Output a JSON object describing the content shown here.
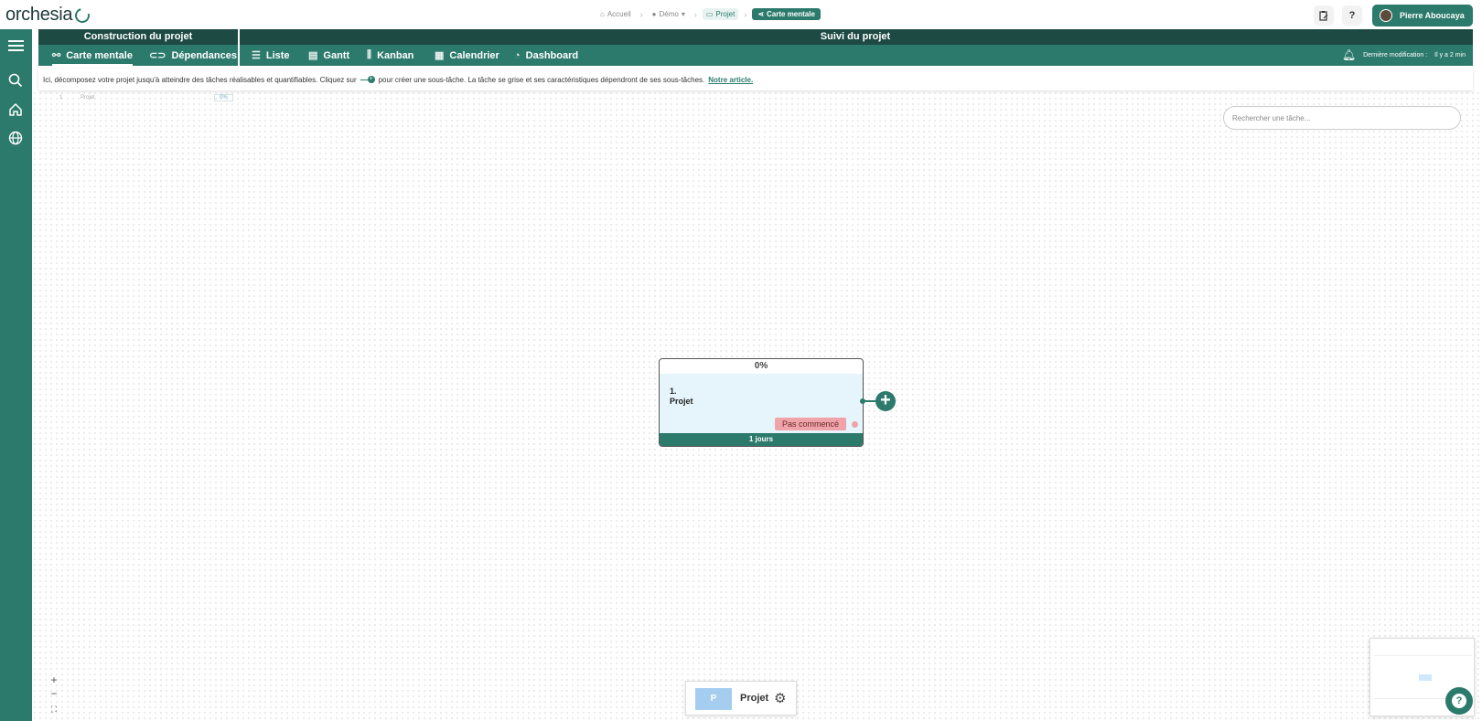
{
  "app": {
    "logo_text": "orchesia"
  },
  "breadcrumb": {
    "items": [
      {
        "label": "Accueil",
        "icon": "home-icon"
      },
      {
        "label": "Démo",
        "icon": "org-icon"
      },
      {
        "label": "Projet",
        "icon": "folder-icon"
      },
      {
        "label": "Carte mentale",
        "icon": "mindmap-icon"
      }
    ]
  },
  "header": {
    "help_label": "?",
    "user_name": "Pierre Aboucaya"
  },
  "nav": {
    "section_build": "Construction du projet",
    "section_follow": "Suivi du projet",
    "tabs": [
      {
        "label": "Carte mentale",
        "icon": "mindmap-icon",
        "active": true
      },
      {
        "label": "Dépendances",
        "icon": "link-icon",
        "active": false
      },
      {
        "label": "Liste",
        "icon": "list-icon",
        "active": false
      },
      {
        "label": "Gantt",
        "icon": "gantt-icon",
        "active": false
      },
      {
        "label": "Kanban",
        "icon": "kanban-icon",
        "active": false
      },
      {
        "label": "Calendrier",
        "icon": "calendar-icon",
        "active": false
      },
      {
        "label": "Dashboard",
        "icon": "dashboard-icon",
        "active": false
      }
    ],
    "last_modified_label": "Dernière modification :",
    "last_modified_value": "Il y a 2 min"
  },
  "info": {
    "text_before": "Ici, décomposez votre projet jusqu'à atteindre des tâches réalisables et quantifiables. Cliquez sur",
    "text_after": "pour créer une sous-tâche.  La tâche se grise et ses caractéristiques dépendront de ses sous-tâches.",
    "link": "Notre article."
  },
  "mini_row": {
    "num": "1",
    "name": "Projet",
    "pct": "0%"
  },
  "search": {
    "placeholder": "Rechercher une tâche..."
  },
  "card": {
    "pct": "0%",
    "number": "1.",
    "title": "Projet",
    "status": "Pas commencé",
    "status_color": "#f0a3a8",
    "duration": "1 jours"
  },
  "zoom": {
    "in": "+",
    "out": "−",
    "fit": "⛶"
  },
  "project_pill": {
    "initial": "P",
    "name": "Projet"
  },
  "colors": {
    "primary": "#2c7a6c",
    "primary_dark": "#1e4a44"
  }
}
